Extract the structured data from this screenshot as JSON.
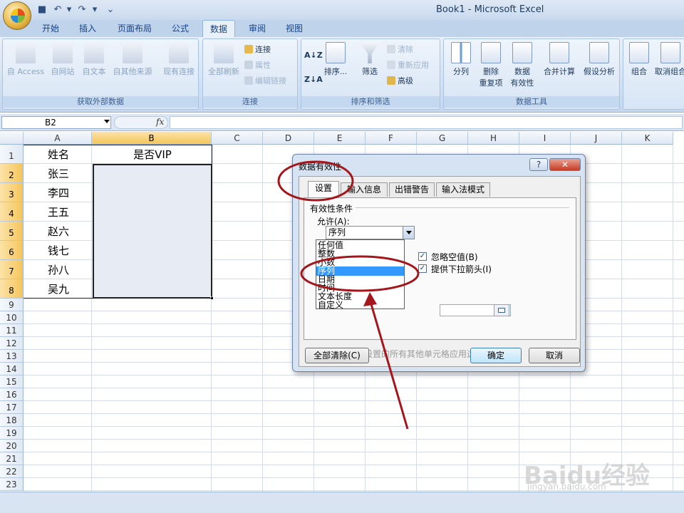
{
  "window": {
    "title": "Book1 - Microsoft Excel"
  },
  "ribbon": {
    "tabs": [
      {
        "label": "开始"
      },
      {
        "label": "插入"
      },
      {
        "label": "页面布局"
      },
      {
        "label": "公式"
      },
      {
        "label": "数据"
      },
      {
        "label": "审阅"
      },
      {
        "label": "视图"
      }
    ],
    "active_tab": "数据",
    "groups": {
      "external": {
        "label": "获取外部数据",
        "buttons": [
          "自 Access",
          "自网站",
          "自文本",
          "自其他来源",
          "现有连接"
        ]
      },
      "connections": {
        "label": "连接",
        "refresh": "全部刷新",
        "items": [
          "连接",
          "属性",
          "编辑链接"
        ]
      },
      "sort_filter": {
        "label": "排序和筛选",
        "sort": "排序...",
        "filter": "筛选",
        "items": [
          "清除",
          "重新应用",
          "高级"
        ]
      },
      "data_tools": {
        "label": "数据工具",
        "split": "分列",
        "remove_dup": [
          "删除",
          "重复项"
        ],
        "validation": [
          "数据",
          "有效性"
        ],
        "consolidate": "合并计算",
        "whatif": "假设分析"
      },
      "outline": {
        "group": "组合",
        "ungroup": "取消组合"
      }
    }
  },
  "formula_bar": {
    "name_box": "B2",
    "fx": "fx",
    "formula": ""
  },
  "sheet": {
    "columns": [
      "A",
      "B",
      "C",
      "D",
      "E",
      "F",
      "G",
      "H",
      "I",
      "J",
      "K"
    ],
    "selected_column": "B",
    "rows": [
      "1",
      "2",
      "3",
      "4",
      "5",
      "6",
      "7",
      "8",
      "9",
      "10",
      "11",
      "12",
      "13",
      "14",
      "15",
      "16",
      "17",
      "18",
      "19",
      "20",
      "21",
      "22",
      "23"
    ],
    "header_row": {
      "a": "姓名",
      "b": "是否VIP"
    },
    "names": [
      "张三",
      "李四",
      "王五",
      "赵六",
      "钱七",
      "孙八",
      "吴九"
    ]
  },
  "dialog": {
    "title": "数据有效性",
    "help": "?",
    "close": "✕",
    "tabs": [
      "设置",
      "输入信息",
      "出错警告",
      "输入法模式"
    ],
    "section": "有效性条件",
    "allow_label": "允许(A):",
    "allow_value": "序列",
    "ignore_blank": "忽略空值(B)",
    "ignore_blank_checked": true,
    "dropdown_arrow": "提供下拉箭头(I)",
    "dropdown_arrow_checked": true,
    "allow_options": [
      "任何值",
      "整数",
      "小数",
      "序列",
      "日期",
      "时间",
      "文本长度",
      "自定义"
    ],
    "selected_option": "序列",
    "apply_all": "对有同样设置的所有其他单元格应用这些更改(P)",
    "clear_all": "全部清除(C)",
    "ok": "确定",
    "cancel": "取消"
  },
  "watermark": {
    "brand": "Baidu经验",
    "url": "jingyan.baidu.com"
  },
  "annotation_color": "#a3171c"
}
